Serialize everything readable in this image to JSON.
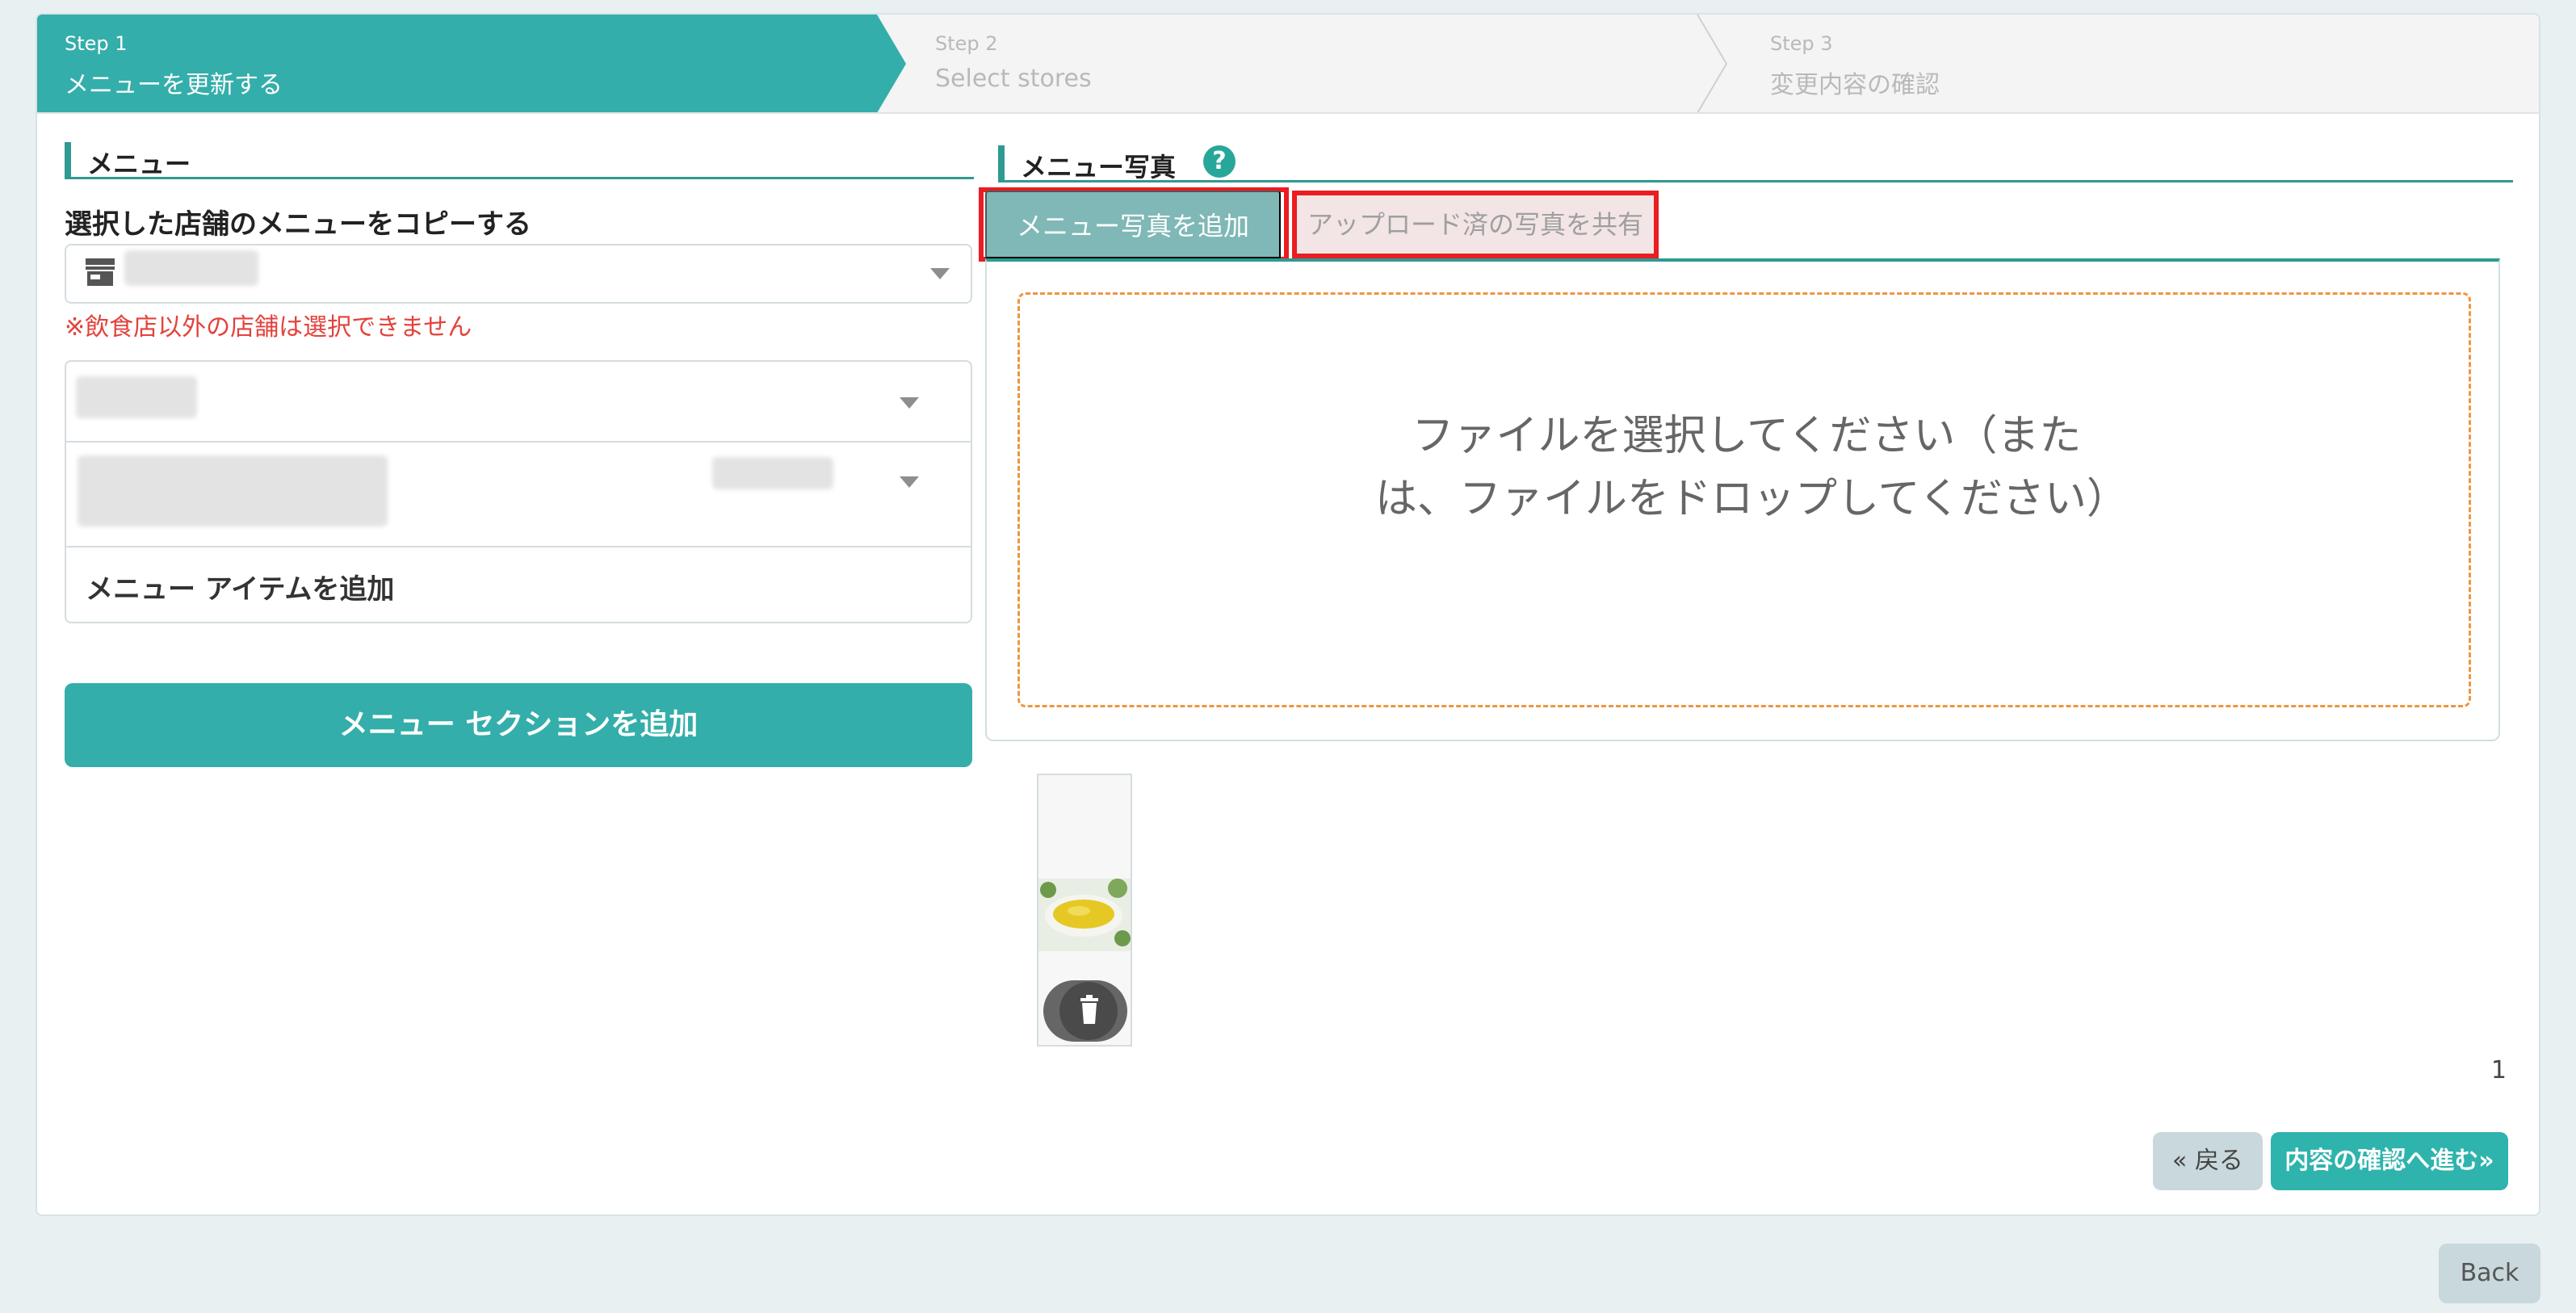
{
  "stepper": {
    "steps": [
      {
        "num": "Step 1",
        "title": "メニューを更新する",
        "active": true
      },
      {
        "num": "Step 2",
        "title": "Select stores",
        "active": false
      },
      {
        "num": "Step 3",
        "title": "変更内容の確認",
        "active": false
      }
    ]
  },
  "menu": {
    "section_title": "メニュー",
    "copy_label": "選択した店舗のメニューをコピーする",
    "store_selected_value": "",
    "warning": "※飲食店以外の店舗は選択できません",
    "add_item_label": "メニュー アイテムを追加",
    "add_section_label": "メニュー セクションを追加"
  },
  "photos": {
    "section_title": "メニュー写真",
    "help_glyph": "?",
    "tab_add": "メニュー写真を追加",
    "tab_share": "アップロード済の写真を共有",
    "dropzone_text": "ファイルを選択してください（または、ファイルをドロップしてください）",
    "page_number": "1"
  },
  "footer": {
    "back_label": "« 戻る",
    "next_label": "内容の確認へ進む»",
    "page_back_label": "Back"
  },
  "colors": {
    "accent": "#34aeaa",
    "stepper_active": "#34aeaa",
    "stepper_inactive": "#f4f4f4",
    "warning": "#e3423c",
    "highlight_border": "#ea1d22",
    "dropzone_border": "#f0953e"
  },
  "icons": {
    "store": "store-icon",
    "help": "help-icon",
    "dropdown": "chevron-down-icon",
    "delete": "trash-icon"
  }
}
